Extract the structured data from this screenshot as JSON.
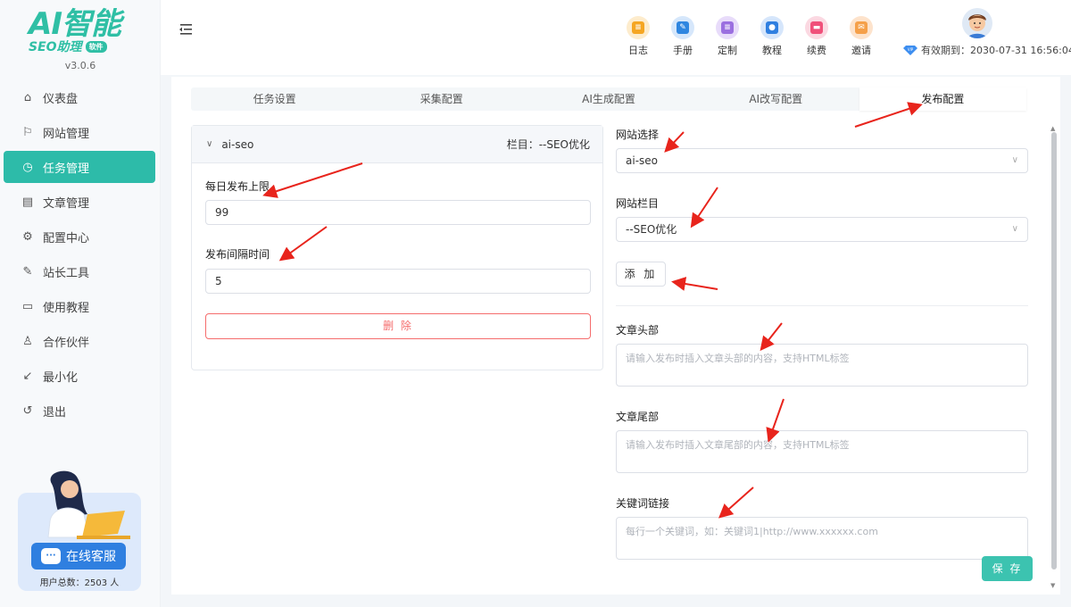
{
  "brand": {
    "logo_main": "AI智能",
    "logo_sub": "SEO助理",
    "logo_badge": "软件",
    "version": "v3.0.6"
  },
  "sidebar": {
    "items": [
      {
        "label": "仪表盘",
        "icon": "home-icon"
      },
      {
        "label": "网站管理",
        "icon": "flag-icon"
      },
      {
        "label": "任务管理",
        "icon": "clock-icon",
        "active": true
      },
      {
        "label": "文章管理",
        "icon": "document-icon"
      },
      {
        "label": "配置中心",
        "icon": "gear-icon"
      },
      {
        "label": "站长工具",
        "icon": "wrench-icon"
      },
      {
        "label": "使用教程",
        "icon": "monitor-icon"
      },
      {
        "label": "合作伙伴",
        "icon": "partner-icon"
      },
      {
        "label": "最小化",
        "icon": "minimize-icon"
      },
      {
        "label": "退出",
        "icon": "logout-icon"
      }
    ],
    "customer_service": "在线客服",
    "user_count": "用户总数：2503 人"
  },
  "header": {
    "tools": [
      {
        "label": "日志",
        "color": "#f5a623",
        "icon": "log-icon"
      },
      {
        "label": "手册",
        "color": "#2f86e0",
        "icon": "manual-icon"
      },
      {
        "label": "定制",
        "color": "#9b6fe0",
        "icon": "custom-icon"
      },
      {
        "label": "教程",
        "color": "#2f7fe0",
        "icon": "tutorial-icon"
      },
      {
        "label": "续费",
        "color": "#f0507a",
        "icon": "renew-icon"
      },
      {
        "label": "邀请",
        "color": "#f5a04a",
        "icon": "invite-icon"
      }
    ],
    "expire_text": "有效期到：2030-07-31 16:56:04"
  },
  "tabs": [
    {
      "label": "任务设置"
    },
    {
      "label": "采集配置"
    },
    {
      "label": "AI生成配置"
    },
    {
      "label": "AI改写配置"
    },
    {
      "label": "发布配置",
      "active": true
    }
  ],
  "site_card": {
    "name": "ai-seo",
    "column_label": "栏目：--SEO优化",
    "daily_limit_label": "每日发布上限",
    "daily_limit_value": "99",
    "interval_label": "发布间隔时间",
    "interval_value": "5",
    "delete_label": "删 除"
  },
  "publish_form": {
    "site_select_label": "网站选择",
    "site_select_value": "ai-seo",
    "column_label": "网站栏目",
    "column_value": "--SEO优化",
    "add_label": "添 加",
    "header_label": "文章头部",
    "header_placeholder": "请输入发布时插入文章头部的内容，支持HTML标签",
    "footer_label": "文章尾部",
    "footer_placeholder": "请输入发布时插入文章尾部的内容，支持HTML标签",
    "keyword_label": "关键词链接",
    "keyword_placeholder": "每行一个关键词，如：关键词1|http://www.xxxxxx.com",
    "save_label": "保 存"
  },
  "colors": {
    "accent": "#2dbba9",
    "danger": "#f56c6c",
    "annotation": "#e8241c"
  }
}
